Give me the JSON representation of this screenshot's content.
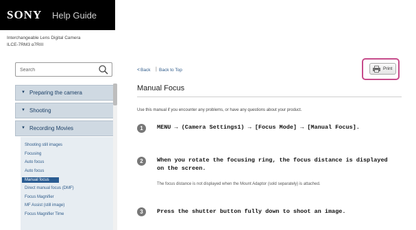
{
  "header": {
    "brand": "SONY",
    "subtitle": "Help Guide"
  },
  "model": {
    "line1": "Interchangeable Lens Digital Camera",
    "line2": "ILCE-7RM3  α7RIII"
  },
  "search": {
    "placeholder": "Search"
  },
  "sidebar": {
    "items": [
      {
        "label": "Preparing the camera"
      },
      {
        "label": "Shooting"
      },
      {
        "label": "Recording Movies"
      }
    ],
    "subitems": [
      {
        "label": "Shooting still images"
      },
      {
        "label": "Focusing"
      },
      {
        "label": "Auto focus"
      },
      {
        "label": "Auto focus"
      },
      {
        "label": "Manual focus"
      },
      {
        "label": "Direct manual focus (DMF)"
      },
      {
        "label": "Focus Magnifier"
      },
      {
        "label": "MF Assist (still image)"
      },
      {
        "label": "Focus Magnifier Time"
      }
    ],
    "active_subitem_index": 4
  },
  "nav": {
    "back": "Back",
    "separator": "|",
    "back_to_top": "Back to Top"
  },
  "print": {
    "label": "Print",
    "highlight_color": "#c64a8a"
  },
  "page": {
    "title": "Manual Focus",
    "intro": "Use this manual if you encounter any problems, or have any questions about your product.",
    "steps": [
      {
        "number": "1",
        "text": "MENU → (Camera Settings1) → [Focus Mode] → [Manual Focus]."
      },
      {
        "number": "2",
        "text": "When you rotate the focusing ring, the focus distance is displayed on the screen.",
        "note": "The focus distance is not displayed when the Mount Adaptor (sold separately) is attached."
      },
      {
        "number": "3",
        "text": "Press the shutter button fully down to shoot an image."
      }
    ]
  },
  "colors": {
    "topbar": "#000000",
    "nav_bg": "#cfd9e2",
    "nav_text": "#1b3f66",
    "active_bg": "#2a5c92"
  }
}
